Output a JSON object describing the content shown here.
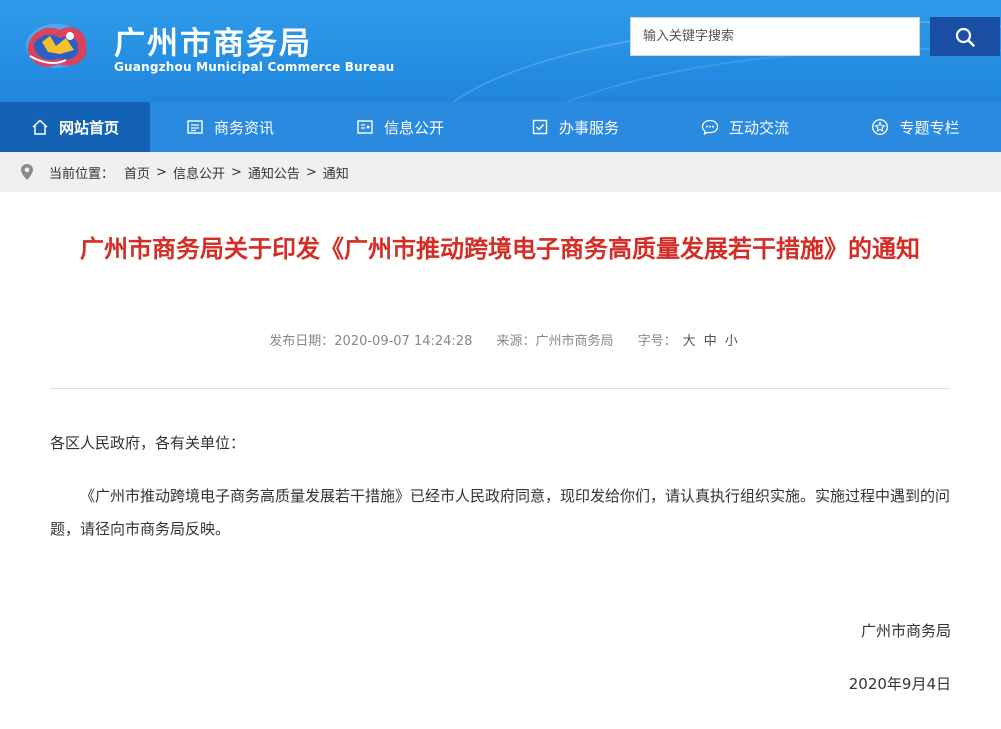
{
  "header": {
    "title": "广州市商务局",
    "subtitle": "Guangzhou Municipal Commerce Bureau",
    "logo_icon": "city-logo-icon",
    "colors": {
      "primary": "#2f9be9",
      "nav": "#2a8ae0",
      "nav_active": "#1462b6",
      "search_button": "#1a4fa3"
    }
  },
  "search": {
    "placeholder": "输入关键字搜索",
    "button_icon": "search-icon"
  },
  "nav": {
    "items": [
      {
        "label": "网站首页",
        "icon": "home-icon",
        "active": true
      },
      {
        "label": "商务资讯",
        "icon": "news-icon",
        "active": false
      },
      {
        "label": "信息公开",
        "icon": "info-icon",
        "active": false
      },
      {
        "label": "办事服务",
        "icon": "checkbox-icon",
        "active": false
      },
      {
        "label": "互动交流",
        "icon": "chat-icon",
        "active": false
      },
      {
        "label": "专题专栏",
        "icon": "star-icon",
        "active": false
      }
    ]
  },
  "breadcrumb": {
    "prefix": "当前位置：",
    "items": [
      "首页",
      "信息公开",
      "通知公告",
      "通知"
    ],
    "separator": ">",
    "icon": "location-pin-icon"
  },
  "article": {
    "title": "广州市商务局关于印发《广州市推动跨境电子商务高质量发展若干措施》的通知",
    "title_color": "#d42d25",
    "published": "发布日期：2020-09-07 14:24:28",
    "source": "来源：广州市商务局",
    "font_size_label": "字号：",
    "font_sizes": [
      "大",
      "中",
      "小"
    ],
    "salutation": "各区人民政府，各有关单位：",
    "body": "《广州市推动跨境电子商务高质量发展若干措施》已经市人民政府同意，现印发给你们，请认真执行组织实施。实施过程中遇到的问题，请径向市商务局反映。",
    "signature": "广州市商务局",
    "date": "2020年9月4日"
  }
}
